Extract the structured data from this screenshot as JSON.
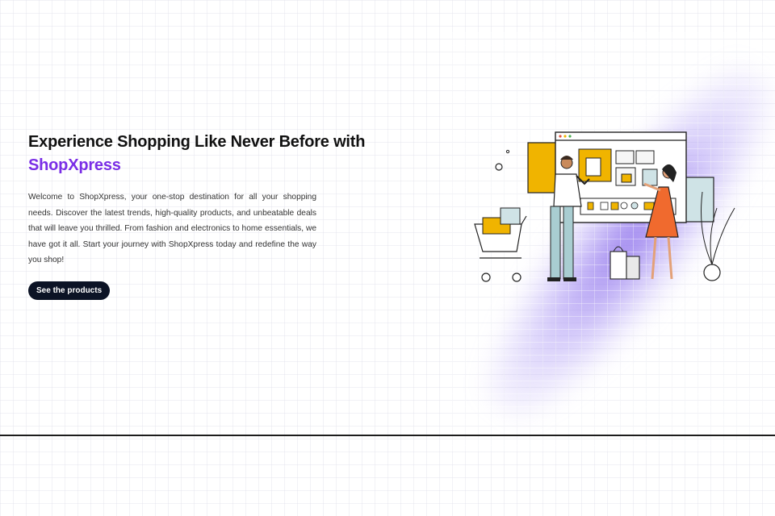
{
  "hero": {
    "headline": "Experience Shopping Like Never Before with",
    "brand": "ShopXpress",
    "description": "Welcome to ShopXpress, your one-stop destination for all your shopping needs. Discover the latest trends, high-quality products, and unbeatable deals that will leave you thrilled. From fashion and electronics to home essentials, we have got it all. Start your journey with ShopXpress today and redefine the way you shop!",
    "cta_label": "See the products"
  },
  "colors": {
    "brand": "#7a2ee6",
    "cta_bg": "#0c1325",
    "glow": "#8c6eeb"
  },
  "illustration": {
    "subject": "online-shopping-illustration",
    "icons": [
      "shopping-cart-icon",
      "shopping-bag-icon",
      "plant-icon",
      "browser-window-icon"
    ]
  }
}
